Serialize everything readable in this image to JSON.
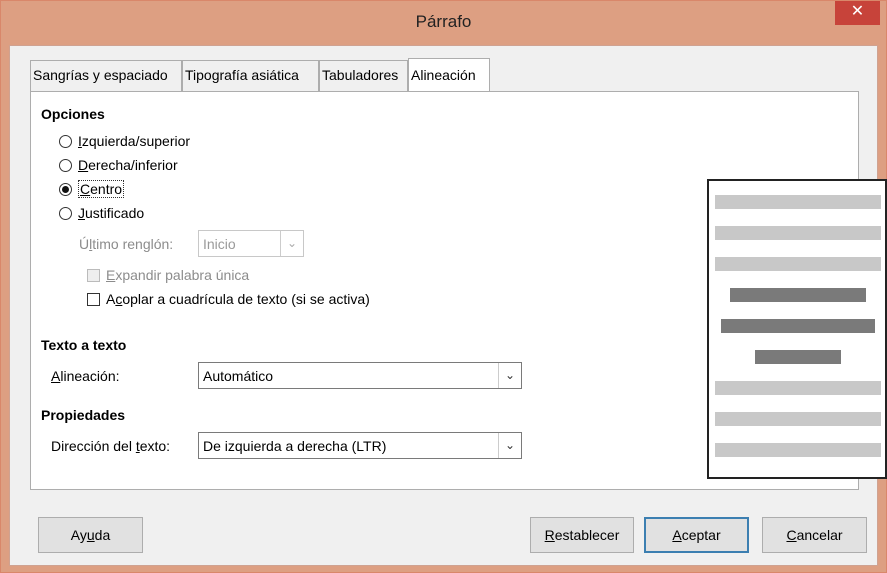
{
  "window": {
    "title": "Párrafo",
    "close_glyph": "✕"
  },
  "tabs": [
    {
      "label": "Sangrías y espaciado"
    },
    {
      "label": "Tipografía asiática"
    },
    {
      "label": "Tabuladores"
    },
    {
      "label": "Alineación"
    }
  ],
  "options": {
    "title": "Opciones",
    "radios": [
      {
        "accel": "I",
        "rest": "zquierda/superior",
        "selected": false
      },
      {
        "accel": "D",
        "rest": "erecha/inferior",
        "selected": false
      },
      {
        "accel": "C",
        "rest": "entro",
        "selected": true
      },
      {
        "accel": "J",
        "rest": "ustificado",
        "selected": false
      }
    ],
    "last_line": {
      "label_pre": "Ú",
      "label_accel": "l",
      "label_post": "timo renglón:",
      "value": "Inicio"
    },
    "expand_word": {
      "accel": "E",
      "rest": "xpandir palabra única"
    },
    "snap_grid": {
      "pre": "A",
      "accel": "c",
      "rest": "oplar a cuadrícula de texto (si se activa)"
    }
  },
  "text_to_text": {
    "title": "Texto a texto",
    "label_accel": "A",
    "label_rest": "lineación:",
    "value": "Automático"
  },
  "properties": {
    "title": "Propiedades",
    "label_pre": "Dirección del ",
    "label_accel": "t",
    "label_post": "exto:",
    "value": "De izquierda a derecha (LTR)"
  },
  "buttons": {
    "help": {
      "pre": "Ay",
      "accel": "u",
      "post": "da"
    },
    "reset": {
      "accel": "R",
      "rest": "establecer"
    },
    "ok": {
      "accel": "A",
      "rest": "ceptar"
    },
    "cancel": {
      "accel": "C",
      "rest": "ancelar"
    }
  },
  "icons": {
    "dropdown": "chevron-down-icon",
    "close": "close-icon"
  },
  "colors": {
    "titlebar": "#dd9f82",
    "close": "#c7433a",
    "default_button_border": "#3c7fb1",
    "preview_light": "#c8c8c8",
    "preview_dark": "#7a7a7a"
  }
}
